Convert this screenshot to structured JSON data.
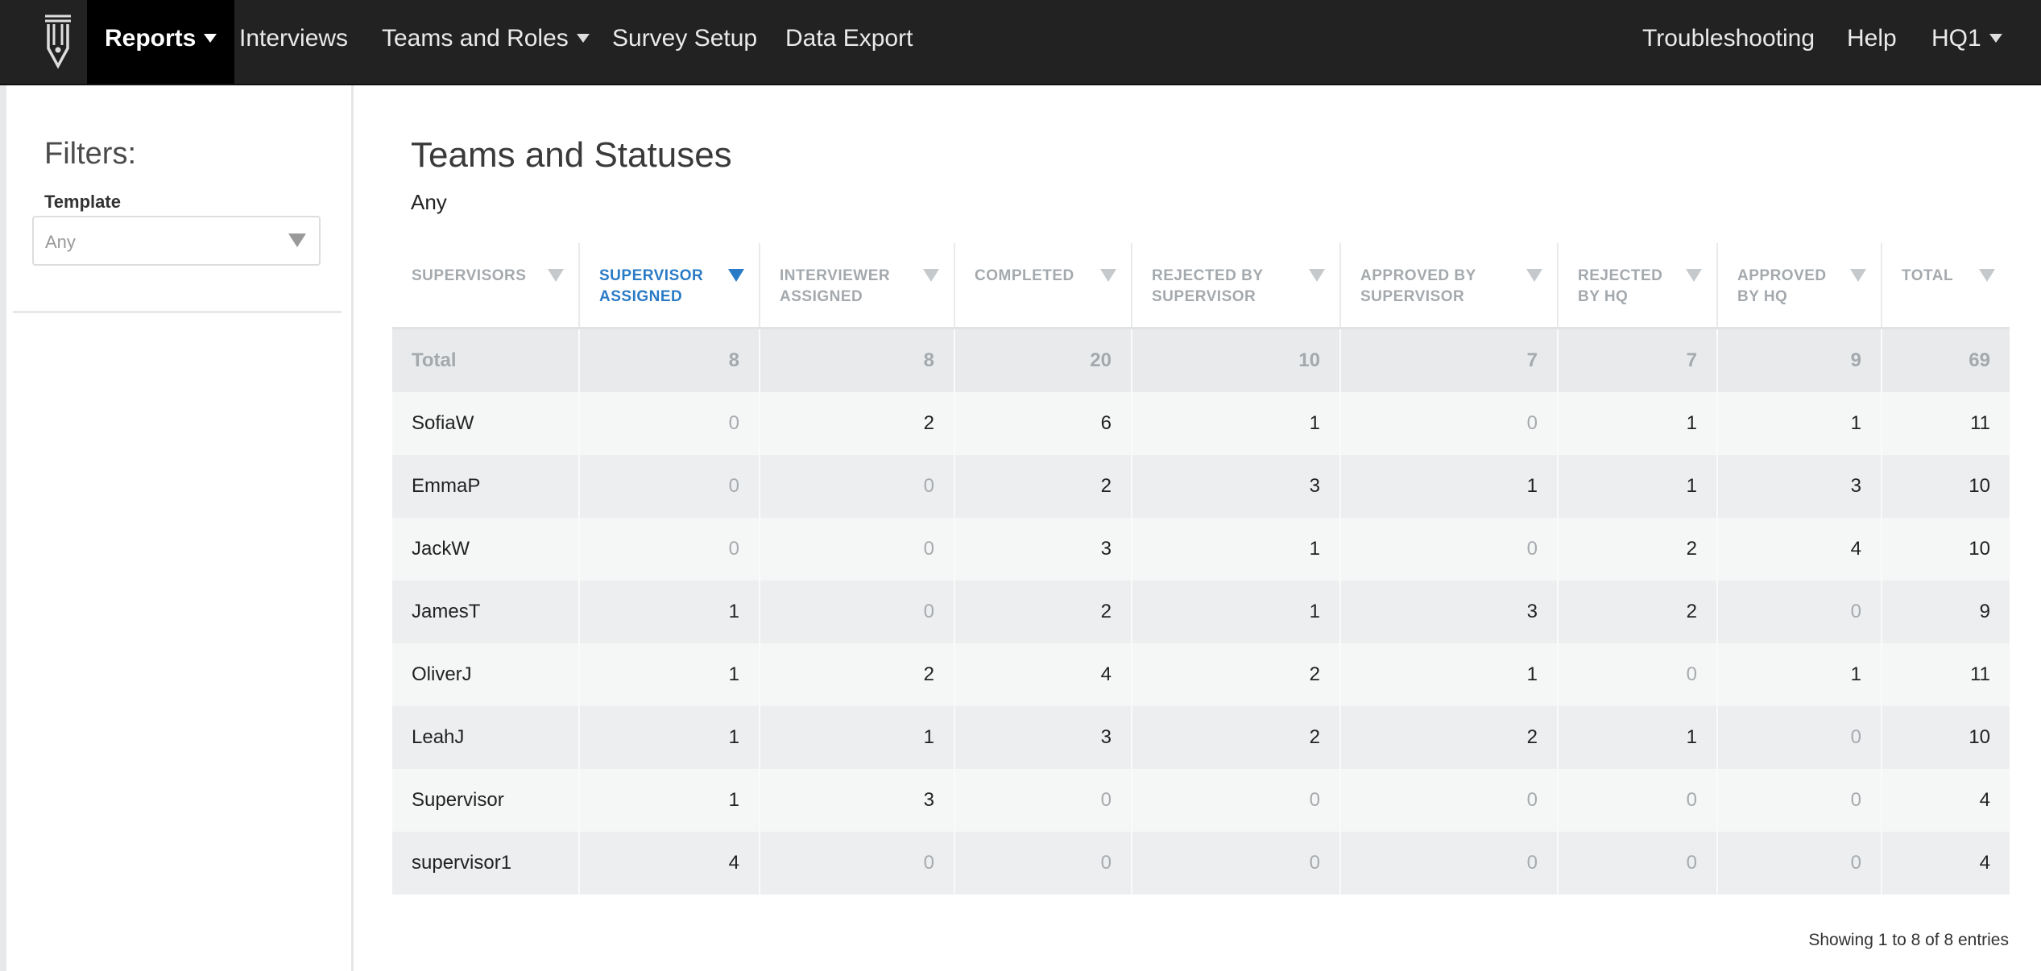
{
  "navbar": {
    "logo_icon": "pen-nib-logo-icon",
    "items": [
      {
        "label": "Reports",
        "dropdown": true,
        "active": true
      },
      {
        "label": "Interviews"
      },
      {
        "label": "Teams and Roles",
        "dropdown": true
      },
      {
        "label": "Survey Setup"
      },
      {
        "label": "Data Export"
      }
    ],
    "right_items": [
      {
        "label": "Troubleshooting"
      },
      {
        "label": "Help"
      },
      {
        "label": "HQ1",
        "dropdown": true
      }
    ]
  },
  "sidebar": {
    "title": "Filters:",
    "template_label": "Template",
    "template_value": "Any"
  },
  "main": {
    "title": "Teams and Statuses",
    "subtitle": "Any"
  },
  "table": {
    "columns": [
      {
        "label": "SUPERVISORS"
      },
      {
        "label": "SUPERVISOR ASSIGNED",
        "sorted": true
      },
      {
        "label": "INTERVIEWER ASSIGNED"
      },
      {
        "label": "COMPLETED"
      },
      {
        "label": "REJECTED BY SUPERVISOR"
      },
      {
        "label": "APPROVED BY SUPERVISOR"
      },
      {
        "label": "REJECTED BY HQ"
      },
      {
        "label": "APPROVED BY HQ"
      },
      {
        "label": "TOTAL"
      }
    ],
    "total_row": [
      "Total",
      "8",
      "8",
      "20",
      "10",
      "7",
      "7",
      "9",
      "69"
    ],
    "rows": [
      [
        "SofiaW",
        "0",
        "2",
        "6",
        "1",
        "0",
        "1",
        "1",
        "11"
      ],
      [
        "EmmaP",
        "0",
        "0",
        "2",
        "3",
        "1",
        "1",
        "3",
        "10"
      ],
      [
        "JackW",
        "0",
        "0",
        "3",
        "1",
        "0",
        "2",
        "4",
        "10"
      ],
      [
        "JamesT",
        "1",
        "0",
        "2",
        "1",
        "3",
        "2",
        "0",
        "9"
      ],
      [
        "OliverJ",
        "1",
        "2",
        "4",
        "2",
        "1",
        "0",
        "1",
        "11"
      ],
      [
        "LeahJ",
        "1",
        "1",
        "3",
        "2",
        "2",
        "1",
        "0",
        "10"
      ],
      [
        "Supervisor",
        "1",
        "3",
        "0",
        "0",
        "0",
        "0",
        "0",
        "4"
      ],
      [
        "supervisor1",
        "4",
        "0",
        "0",
        "0",
        "0",
        "0",
        "0",
        "4"
      ]
    ],
    "info": "Showing 1 to 8 of 8 entries"
  }
}
